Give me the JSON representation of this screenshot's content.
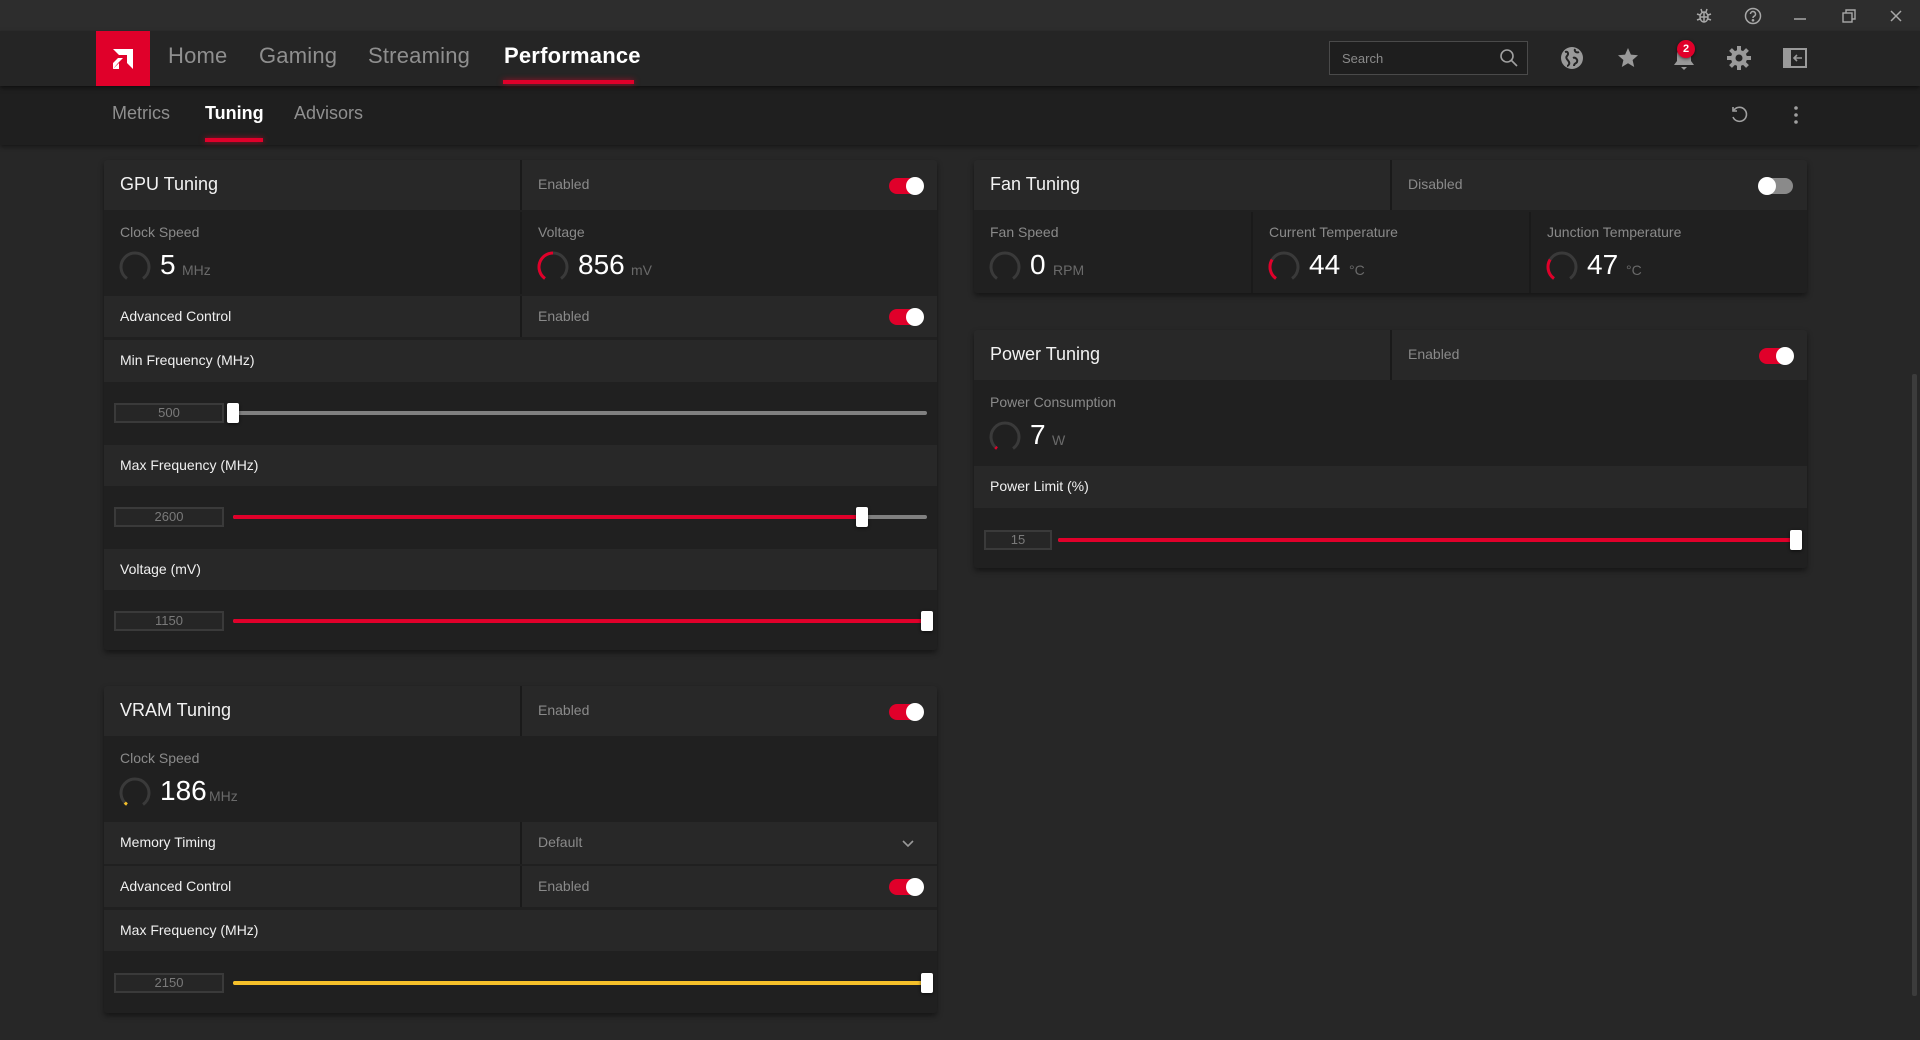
{
  "window": {
    "controls": [
      "bug-report",
      "help",
      "minimize",
      "restore",
      "close"
    ]
  },
  "nav": {
    "items": [
      {
        "label": "Home",
        "active": false
      },
      {
        "label": "Gaming",
        "active": false
      },
      {
        "label": "Streaming",
        "active": false
      },
      {
        "label": "Performance",
        "active": true
      }
    ],
    "search_placeholder": "Search",
    "notification_count": "2",
    "icons": [
      "globe-icon",
      "star-icon",
      "bell-icon",
      "gear-icon",
      "sidebar-toggle-icon"
    ]
  },
  "subnav": {
    "items": [
      {
        "label": "Metrics",
        "active": false
      },
      {
        "label": "Tuning",
        "active": true
      },
      {
        "label": "Advisors",
        "active": false
      }
    ]
  },
  "colors": {
    "accent": "#e0002a",
    "vram_accent": "#f5c02a",
    "background": "#272727"
  },
  "gpu_tuning": {
    "title": "GPU Tuning",
    "status": "Enabled",
    "enabled": true,
    "clock_speed": {
      "label": "Clock Speed",
      "value": "5",
      "unit": "MHz",
      "gauge_fraction": 0.0
    },
    "voltage": {
      "label": "Voltage",
      "value": "856",
      "unit": "mV",
      "gauge_fraction": 0.5
    },
    "advanced_control": {
      "label": "Advanced Control",
      "status": "Enabled",
      "enabled": true
    },
    "min_frequency": {
      "label": "Min Frequency (MHz)",
      "value": "500",
      "fraction": 0.0
    },
    "max_frequency": {
      "label": "Max Frequency (MHz)",
      "value": "2600",
      "fraction": 0.906
    },
    "voltage_slider": {
      "label": "Voltage (mV)",
      "value": "1150",
      "fraction": 1.0
    }
  },
  "vram_tuning": {
    "title": "VRAM Tuning",
    "status": "Enabled",
    "enabled": true,
    "clock_speed": {
      "label": "Clock Speed",
      "value": "186",
      "unit": "MHz",
      "gauge_fraction": 0.04
    },
    "memory_timing": {
      "label": "Memory Timing",
      "value": "Default"
    },
    "advanced_control": {
      "label": "Advanced Control",
      "status": "Enabled",
      "enabled": true
    },
    "max_frequency": {
      "label": "Max Frequency (MHz)",
      "value": "2150",
      "fraction": 1.0
    }
  },
  "fan_tuning": {
    "title": "Fan Tuning",
    "status": "Disabled",
    "enabled": false,
    "fan_speed": {
      "label": "Fan Speed",
      "value": "0",
      "unit": "RPM",
      "gauge_fraction": 0.0
    },
    "current_temperature": {
      "label": "Current Temperature",
      "value": "44",
      "unit": "°C",
      "gauge_fraction": 0.3
    },
    "junction_temperature": {
      "label": "Junction Temperature",
      "value": "47",
      "unit": "°C",
      "gauge_fraction": 0.3
    }
  },
  "power_tuning": {
    "title": "Power Tuning",
    "status": "Enabled",
    "enabled": true,
    "power_consumption": {
      "label": "Power Consumption",
      "value": "7",
      "unit": "W",
      "gauge_fraction": 0.03
    },
    "power_limit": {
      "label": "Power Limit (%)",
      "value": "15",
      "fraction": 1.0
    }
  }
}
